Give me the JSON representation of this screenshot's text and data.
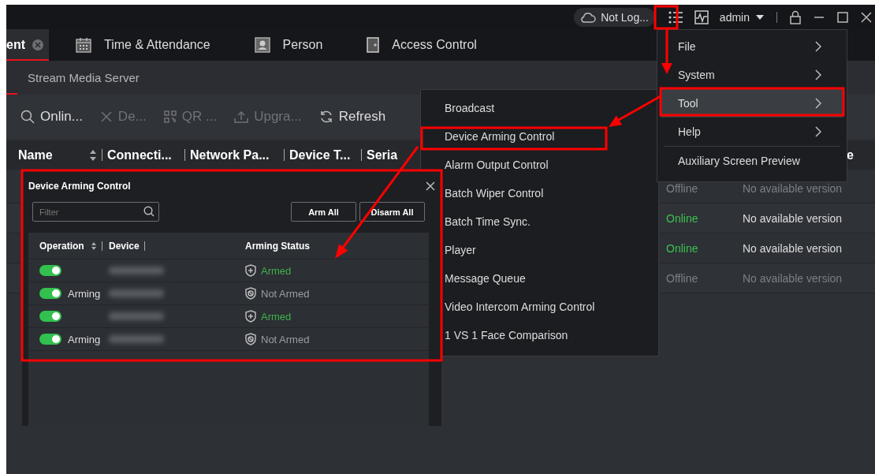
{
  "top_bar": {
    "cloud_status": "Not Log...",
    "user": "admin"
  },
  "tabs": [
    {
      "label": "ent",
      "selected": true,
      "closable": true
    },
    {
      "label": "Time & Attendance",
      "selected": false,
      "kind": "calendar"
    },
    {
      "label": "Person",
      "selected": false,
      "kind": "person"
    },
    {
      "label": "Access Control",
      "selected": false,
      "kind": "door"
    }
  ],
  "sub_tabs": [
    {
      "selected": true
    },
    {
      "label": "Stream Media Server",
      "selected": false
    }
  ],
  "toolbar": [
    {
      "kind": "search",
      "label": "Onlin...",
      "disabled": false
    },
    {
      "kind": "close",
      "label": "De...",
      "disabled": true
    },
    {
      "kind": "qr",
      "label": "QR ...",
      "disabled": true
    },
    {
      "kind": "upload",
      "label": "Upgra...",
      "disabled": true
    },
    {
      "kind": "refresh",
      "label": "Refresh",
      "disabled": false
    }
  ],
  "table": {
    "columns": [
      {
        "label": "Name",
        "sortable": true
      },
      {
        "label": "Connecti...",
        "sortable": false
      },
      {
        "label": "Network Pa...",
        "sortable": false
      },
      {
        "label": "Device T...",
        "sortable": false
      },
      {
        "label": "Seria",
        "sortable": false
      },
      {
        "label": "e",
        "sortable": false
      }
    ],
    "rows": [
      {
        "status": "Offline",
        "online": false,
        "version": "No available version"
      },
      {
        "status": "Online",
        "online": true,
        "version": "No available version"
      },
      {
        "status": "Online",
        "online": true,
        "version": "No available version"
      },
      {
        "status": "Offline",
        "online": false,
        "version": "No available version"
      }
    ]
  },
  "main_menu": {
    "items": [
      {
        "label": "File",
        "submenu": true,
        "selected": false
      },
      {
        "label": "System",
        "submenu": true,
        "selected": false
      },
      {
        "label": "Tool",
        "submenu": true,
        "selected": true
      },
      {
        "label": "Help",
        "submenu": true,
        "selected": false
      },
      {
        "label": "Auxiliary Screen Preview",
        "submenu": false,
        "selected": false,
        "separator_before": true
      }
    ]
  },
  "tool_submenu": {
    "items": [
      "Broadcast",
      "Device Arming Control",
      "Alarm Output Control",
      "Batch Wiper Control",
      "Batch Time Sync.",
      "Player",
      "Message Queue",
      "Video Intercom Arming Control",
      "1 VS 1 Face Comparison"
    ]
  },
  "dialog": {
    "title": "Device Arming Control",
    "filter_placeholder": "Filter",
    "buttons": [
      "Arm All",
      "Disarm All"
    ],
    "columns": [
      {
        "label": "Operation",
        "sortable": true
      },
      {
        "label": "Device",
        "sortable": false
      },
      {
        "label": "Arming Status",
        "sortable": false
      }
    ],
    "rows": [
      {
        "on": true,
        "status": "Armed",
        "armed": true
      },
      {
        "on": true,
        "label": "Arming",
        "status": "Not Armed",
        "armed": false
      },
      {
        "on": true,
        "status": "Armed",
        "armed": true
      },
      {
        "on": true,
        "label": "Arming",
        "status": "Not Armed",
        "armed": false
      }
    ]
  }
}
